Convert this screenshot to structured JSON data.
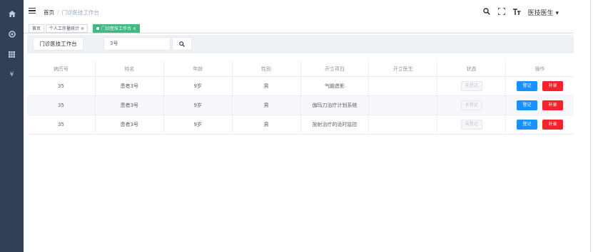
{
  "navbar": {
    "breadcrumb": [
      "首页",
      "门诊医技工作台"
    ],
    "breadcrumb_sep": "/",
    "user_name": "医技医生"
  },
  "tags": [
    "首页",
    "个人工作量统计",
    "门诊医技工作台"
  ],
  "filter": {
    "title": "门诊医技工作台",
    "search_value": "3号"
  },
  "table": {
    "headers": [
      "病历号",
      "姓名",
      "年龄",
      "性别",
      "开立项目",
      "开立医生",
      "状态",
      "操作"
    ],
    "rows": [
      [
        "35",
        "患者3号",
        "9岁",
        "男",
        "气脑造影",
        "",
        "未登记"
      ],
      [
        "35",
        "患者3号",
        "9岁",
        "男",
        "伽玛刀治疗计划系统",
        "",
        "未登记"
      ],
      [
        "35",
        "患者3号",
        "9岁",
        "男",
        "放射治疗的适时监控",
        "",
        "未登记"
      ]
    ],
    "register_label": "登记",
    "supplement_label": "补录"
  },
  "colors": {
    "sidebar": "#304156",
    "active_tag": "#42b983",
    "register_btn": "#1890ff",
    "supplement_btn": "#f5222d"
  }
}
